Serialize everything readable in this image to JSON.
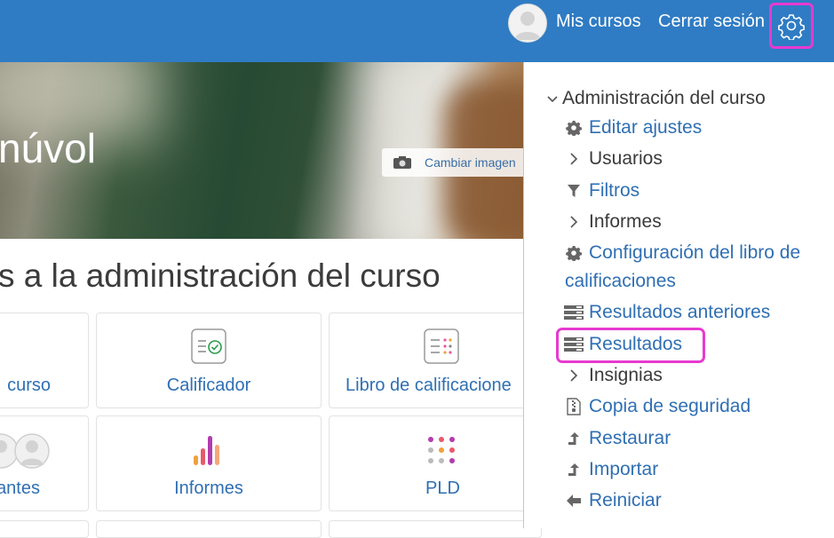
{
  "navbar": {
    "my_courses": "Mis cursos",
    "logout": "Cerrar sesión"
  },
  "hero": {
    "title_fragment": "núvol",
    "change_image": "Cambiar imagen"
  },
  "section": {
    "title_fragment": "s a la administración del curso"
  },
  "cards": [
    {
      "label": "curso"
    },
    {
      "label": "Calificador"
    },
    {
      "label": "Libro de calificacione"
    },
    {
      "label": "antes"
    },
    {
      "label": "Informes"
    },
    {
      "label": "PLD"
    }
  ],
  "drawer": {
    "title": "Administración del curso",
    "items": [
      {
        "label": "Editar ajustes",
        "icon": "gear-icon"
      },
      {
        "label": "Usuarios",
        "icon": "chevron-right-icon"
      },
      {
        "label": "Filtros",
        "icon": "filter-icon"
      },
      {
        "label": "Informes",
        "icon": "chevron-right-icon"
      },
      {
        "label_line1": "Configuración del libro de",
        "label_line2": "calificaciones",
        "icon": "gear-icon"
      },
      {
        "label": "Resultados anteriores",
        "icon": "outcomes-icon"
      },
      {
        "label": "Resultados",
        "icon": "outcomes-icon"
      },
      {
        "label": "Insignias",
        "icon": "chevron-right-icon"
      },
      {
        "label": "Copia de seguridad",
        "icon": "file-archive-icon"
      },
      {
        "label": "Restaurar",
        "icon": "arrow-up-icon"
      },
      {
        "label": "Importar",
        "icon": "arrow-up-icon"
      },
      {
        "label": "Reiniciar",
        "icon": "arrow-left-icon"
      }
    ]
  },
  "colors": {
    "navbar": "#2f7cc4",
    "link": "#2f6fb3",
    "highlight": "#e73ad1"
  }
}
